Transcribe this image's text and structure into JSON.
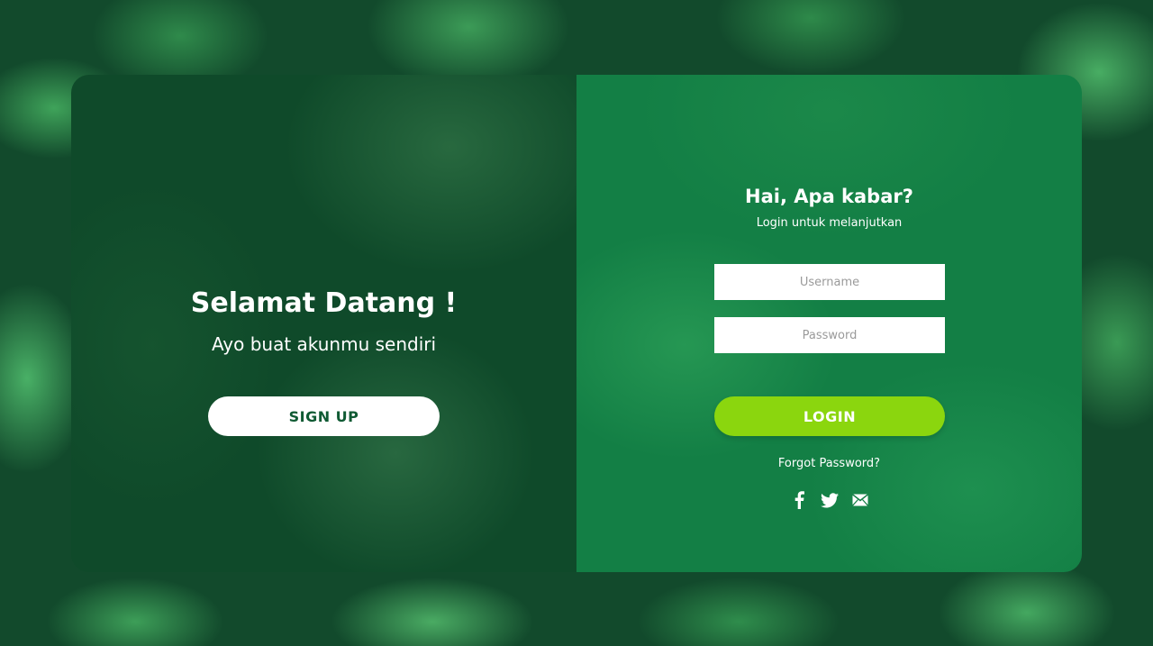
{
  "welcome": {
    "title": "Selamat Datang !",
    "subtitle": "Ayo buat akunmu sendiri",
    "signup_label": "SIGN UP"
  },
  "login": {
    "title": "Hai, Apa kabar?",
    "subtitle": "Login untuk melanjutkan",
    "username_placeholder": "Username",
    "password_placeholder": "Password",
    "login_label": "LOGIN",
    "forgot_label": "Forgot Password?"
  },
  "social": [
    {
      "icon": "facebook-icon"
    },
    {
      "icon": "twitter-icon"
    },
    {
      "icon": "mail-icon"
    }
  ],
  "colors": {
    "login_button": "#8bd60e",
    "signup_text": "#0f5a33",
    "left_panel": "#0f4a2a",
    "right_panel": "#137f45"
  }
}
